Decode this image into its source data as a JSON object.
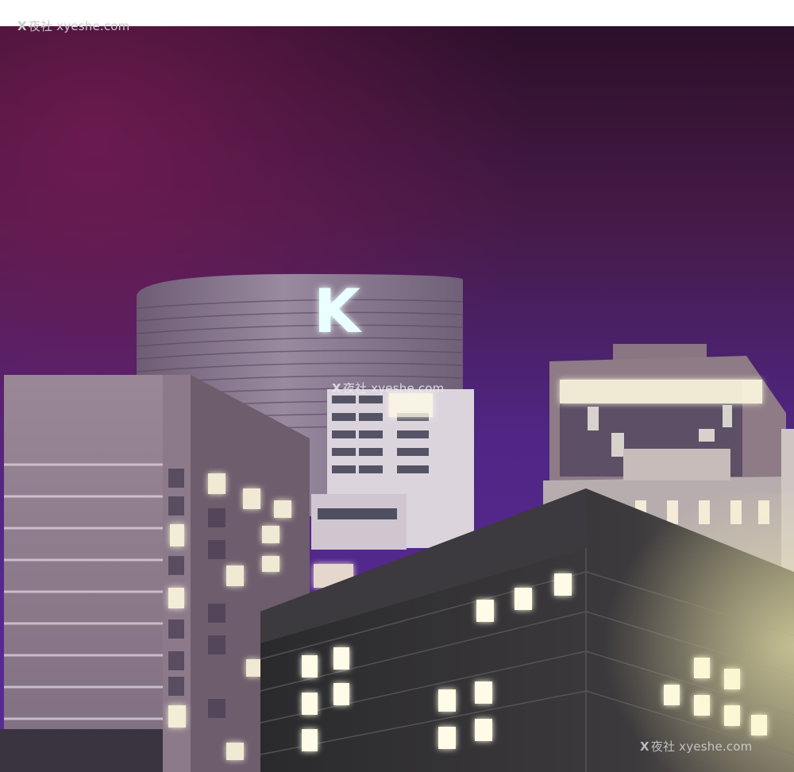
{
  "watermarks": {
    "top": {
      "mark": "X",
      "text": "夜社 xyeshe.com"
    },
    "middle": {
      "mark": "X",
      "text": "夜社 xyeshe.com"
    },
    "bottom": {
      "mark": "X",
      "text": "夜社 xyeshe.com"
    }
  },
  "scene": {
    "tower_sign": "K",
    "colors": {
      "sky_top": "#2b0f2a",
      "sky_magenta": "#6a1a4a",
      "sky_purple": "#5a2a9a",
      "building_mauve": "#8a7282",
      "building_dark": "#2e2a30",
      "window_glow": "#fffbe6"
    }
  }
}
